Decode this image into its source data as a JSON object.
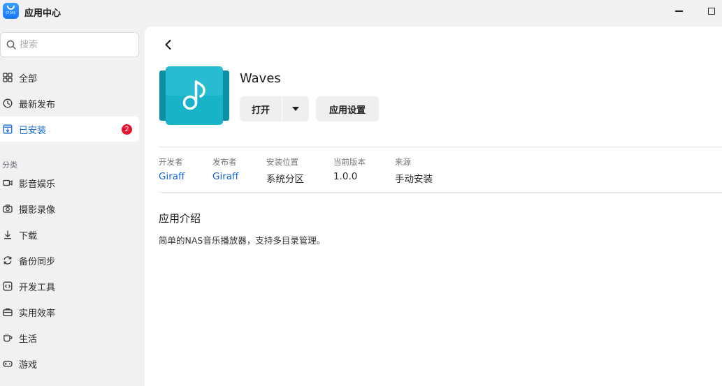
{
  "window": {
    "title": "应用中心",
    "logo_text": "STORE"
  },
  "sidebar": {
    "search_placeholder": "搜索",
    "items": [
      {
        "label": "全部"
      },
      {
        "label": "最新发布"
      },
      {
        "label": "已安装",
        "badge": "2"
      }
    ],
    "section_label": "分类",
    "categories": [
      {
        "label": "影音娱乐"
      },
      {
        "label": "摄影录像"
      },
      {
        "label": "下载"
      },
      {
        "label": "备份同步"
      },
      {
        "label": "开发工具"
      },
      {
        "label": "实用效率"
      },
      {
        "label": "生活"
      },
      {
        "label": "游戏"
      }
    ]
  },
  "app": {
    "name": "Waves",
    "open_label": "打开",
    "settings_label": "应用设置",
    "meta": [
      {
        "label": "开发者",
        "value": "Giraff"
      },
      {
        "label": "发布者",
        "value": "Giraff"
      },
      {
        "label": "安装位置",
        "value": "系统分区"
      },
      {
        "label": "当前版本",
        "value": "1.0.0"
      },
      {
        "label": "来源",
        "value": "手动安装"
      }
    ],
    "intro_title": "应用介绍",
    "intro_text": "简单的NAS音乐播放器，支持多目录管理。"
  },
  "colors": {
    "accent": "#1466d6",
    "badge": "#e8122d",
    "icon_teal": "#19b3c9"
  }
}
